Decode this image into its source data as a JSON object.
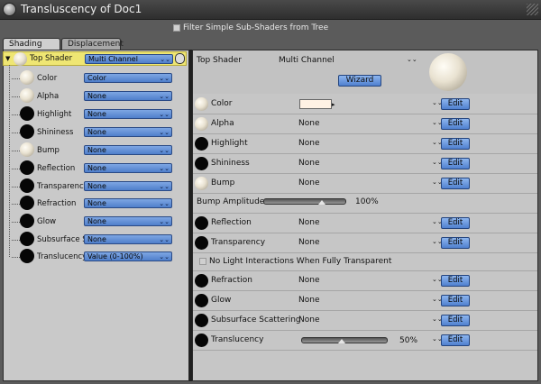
{
  "window": {
    "title": "Transluscency of Doc1"
  },
  "filter": {
    "label": "Filter Simple Sub-Shaders from Tree"
  },
  "tabs": [
    {
      "label": "Shading"
    },
    {
      "label": "Displacement"
    }
  ],
  "tree": {
    "top": {
      "label": "Top Shader",
      "value": "Multi Channel"
    },
    "items": [
      {
        "label": "Color",
        "value": "Color",
        "ball": "cream"
      },
      {
        "label": "Alpha",
        "value": "None",
        "ball": "cream"
      },
      {
        "label": "Highlight",
        "value": "None",
        "ball": "black"
      },
      {
        "label": "Shininess",
        "value": "None",
        "ball": "black"
      },
      {
        "label": "Bump",
        "value": "None",
        "ball": "cream"
      },
      {
        "label": "Reflection",
        "value": "None",
        "ball": "black"
      },
      {
        "label": "Transparency",
        "value": "None",
        "ball": "black"
      },
      {
        "label": "Refraction",
        "value": "None",
        "ball": "black"
      },
      {
        "label": "Glow",
        "value": "None",
        "ball": "black"
      },
      {
        "label": "Subsurface Sc",
        "value": "None",
        "ball": "black"
      },
      {
        "label": "Translucency",
        "value": "Value (0-100%)",
        "ball": "black"
      }
    ]
  },
  "detail": {
    "header_label": "Top Shader",
    "header_value": "Multi Channel",
    "wizard_label": "Wizard",
    "edit_label": "Edit",
    "channels": [
      {
        "label": "Color",
        "value": "",
        "ball": "cream",
        "swatch": "#fff2e4"
      },
      {
        "label": "Alpha",
        "value": "None",
        "ball": "cream"
      },
      {
        "label": "Highlight",
        "value": "None",
        "ball": "black"
      },
      {
        "label": "Shininess",
        "value": "None",
        "ball": "black"
      },
      {
        "label": "Bump",
        "value": "None",
        "ball": "cream"
      },
      {
        "label": "Reflection",
        "value": "None",
        "ball": "black"
      },
      {
        "label": "Transparency",
        "value": "None",
        "ball": "black"
      },
      {
        "label": "Refraction",
        "value": "None",
        "ball": "black"
      },
      {
        "label": "Glow",
        "value": "None",
        "ball": "black"
      },
      {
        "label": "Subsurface Scattering",
        "value": "None",
        "ball": "black"
      },
      {
        "label": "Translucency",
        "value": "",
        "ball": "black"
      }
    ],
    "bump_amplitude": {
      "label": "Bump Amplitude",
      "percent_text": "100%",
      "level": 1.0
    },
    "no_light": {
      "label": "No Light Interactions When Fully Transparent"
    },
    "translucency": {
      "percent_text": "50%",
      "level": 0.5
    }
  }
}
